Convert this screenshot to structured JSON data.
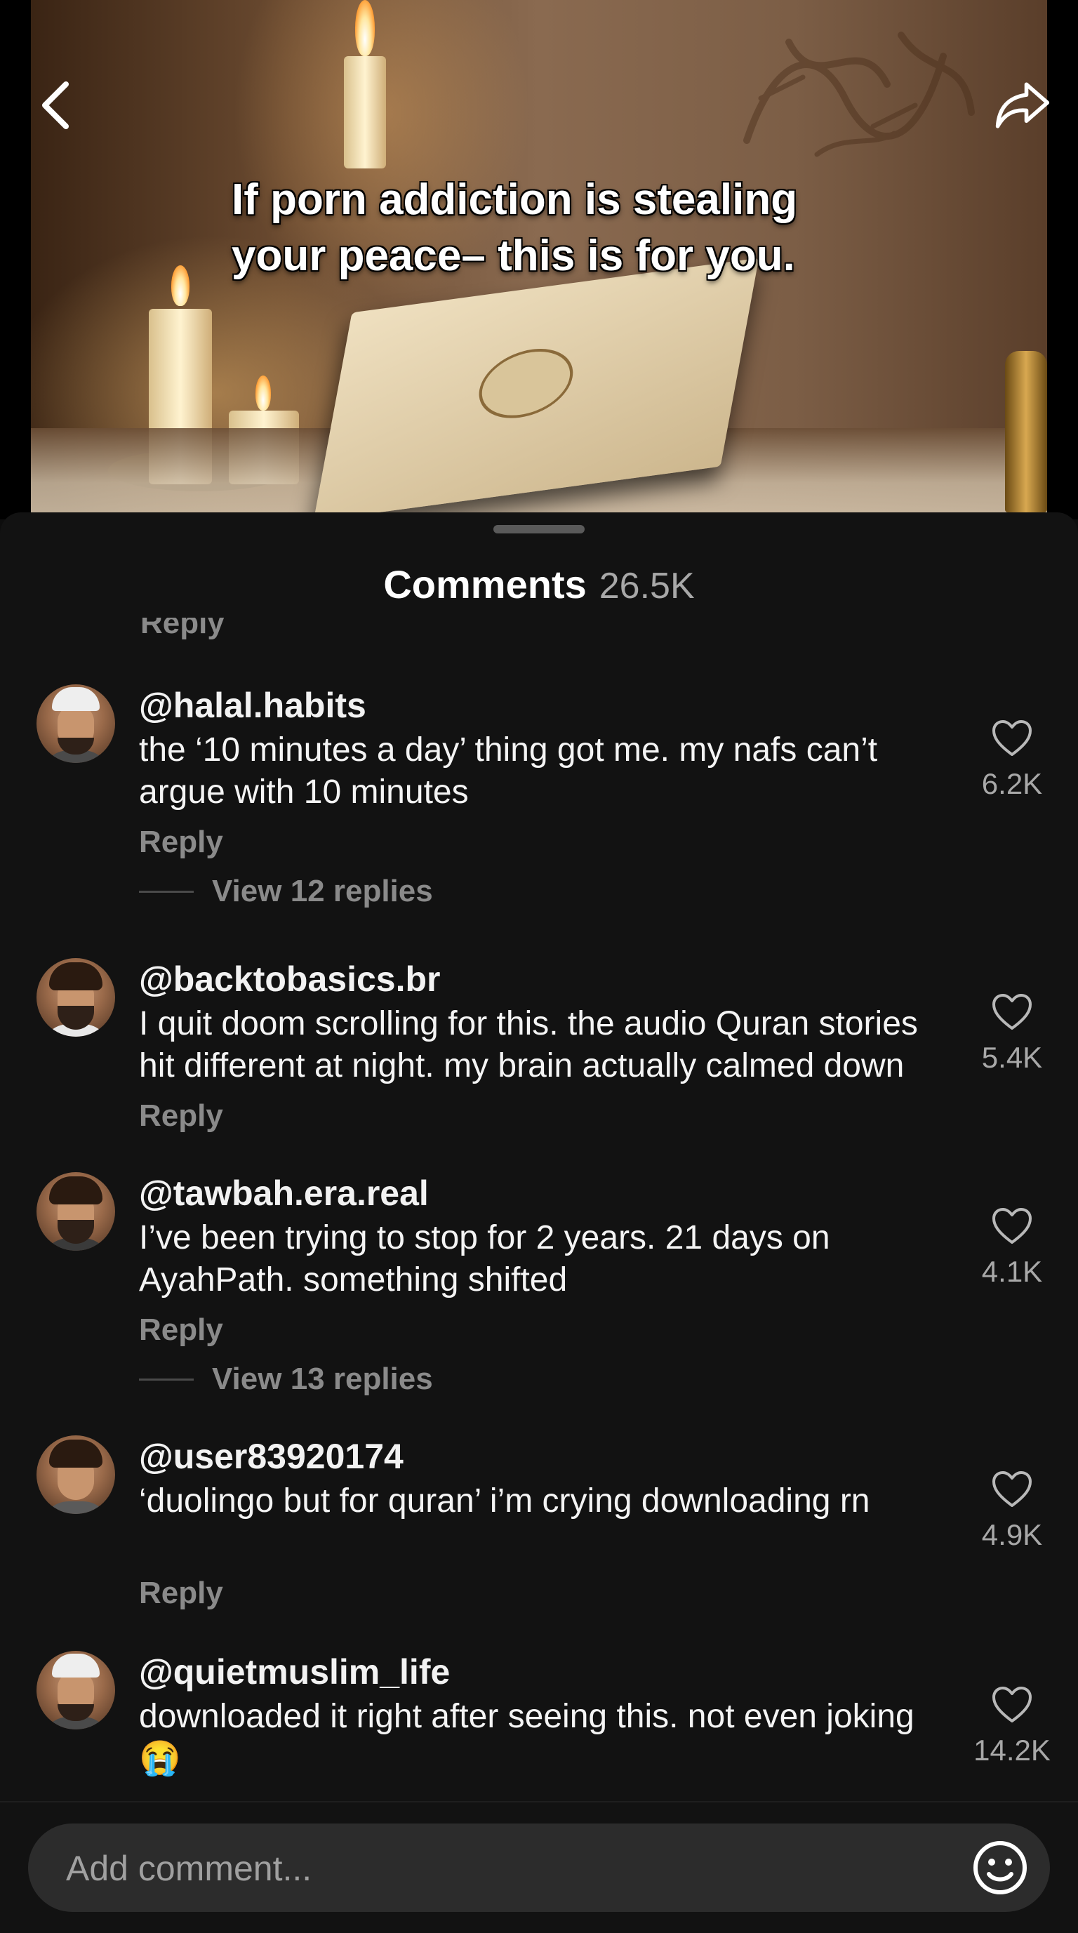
{
  "video": {
    "caption_line1": "If porn addiction is stealing",
    "caption_line2": "your peace– this is for you.",
    "back_icon": "chevron-left-icon",
    "share_icon": "share-arrow-icon"
  },
  "comments_sheet": {
    "title": "Comments",
    "count": "26.5K",
    "partial_reply_label": "Reply",
    "comments": [
      {
        "username": "@halal.habits",
        "text": "the ‘10 minutes a day’ thing got me. my nafs can’t argue with 10 minutes",
        "likes": "6.2K",
        "reply_label": "Reply",
        "view_replies": "View 12 replies"
      },
      {
        "username": "@backtobasics.br",
        "text": "I quit doom scrolling for this. the audio Quran stories hit different at night. my brain actually calmed down",
        "likes": "5.4K",
        "reply_label": "Reply"
      },
      {
        "username": "@tawbah.era.real",
        "text": "I’ve been trying to stop for 2 years. 21 days on AyahPath. something shifted",
        "likes": "4.1K",
        "reply_label": "Reply",
        "view_replies": "View 13 replies"
      },
      {
        "username": "@user83920174",
        "text": "‘duolingo but for quran’ i’m crying downloading rn",
        "likes": "4.9K",
        "reply_label": "Reply"
      },
      {
        "username": "@quietmuslim_life",
        "text": "downloaded it right after seeing this. not even joking 😭",
        "likes": "14.2K"
      }
    ]
  },
  "composer": {
    "placeholder": "Add comment...",
    "emoji_icon": "smiley-icon"
  }
}
